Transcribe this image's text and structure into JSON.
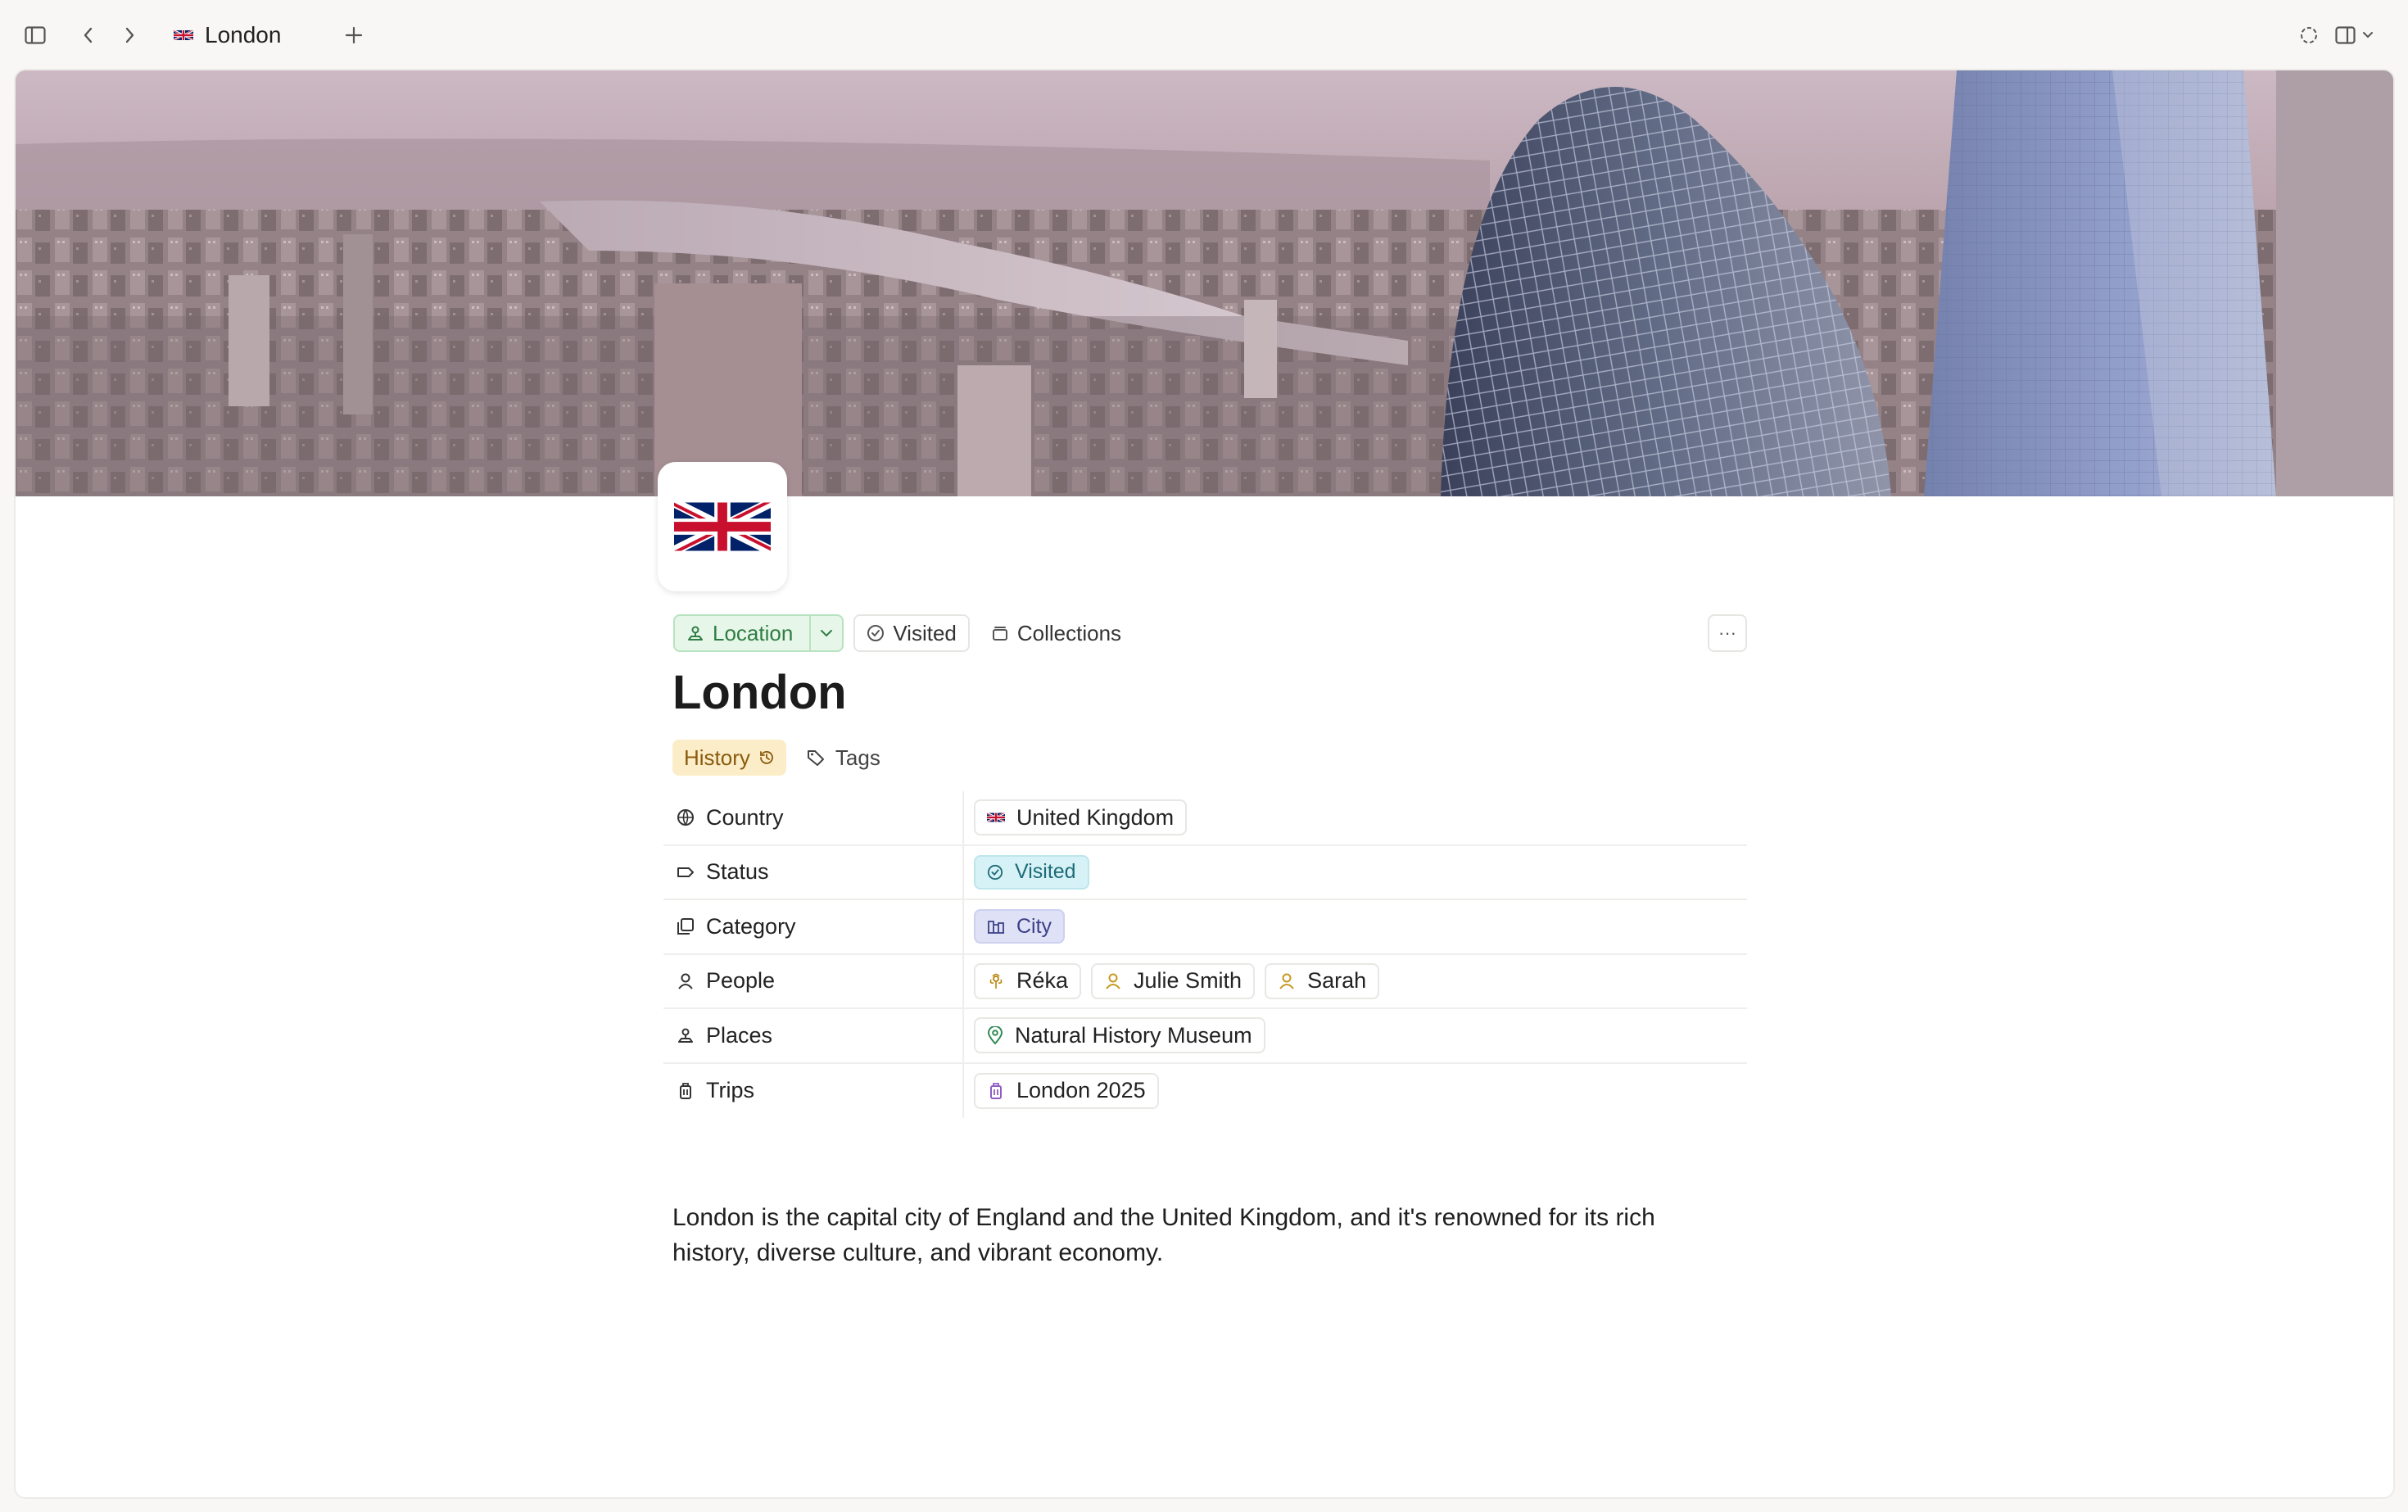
{
  "titlebar": {
    "tab_title": "London"
  },
  "page": {
    "title": "London",
    "type_chip": "Location",
    "status_chip": "Visited",
    "collections_label": "Collections",
    "more_label": "···",
    "tags": {
      "history_label": "History",
      "add_tags_label": "Tags"
    },
    "properties": [
      {
        "key": "Country",
        "icon": "globe-icon",
        "value": "United Kingdom"
      },
      {
        "key": "Status",
        "icon": "tag-label-icon",
        "value": "Visited"
      },
      {
        "key": "Category",
        "icon": "stack-icon",
        "value": "City"
      },
      {
        "key": "People",
        "icon": "person-icon",
        "values": [
          "Réka",
          "Julie Smith",
          "Sarah"
        ]
      },
      {
        "key": "Places",
        "icon": "place-icon",
        "value": "Natural History Museum"
      },
      {
        "key": "Trips",
        "icon": "luggage-icon",
        "value": "London 2025"
      }
    ],
    "body": "London is the capital city of England and the United Kingdom, and it's renowned for its rich history, diverse culture, and vibrant economy."
  },
  "colors": {
    "location_chip_bg": "#e6f6e9",
    "history_tag_bg": "#fbedc7",
    "visited_badge_bg": "#d6f2f6",
    "city_badge_bg": "#dfe1f7"
  }
}
